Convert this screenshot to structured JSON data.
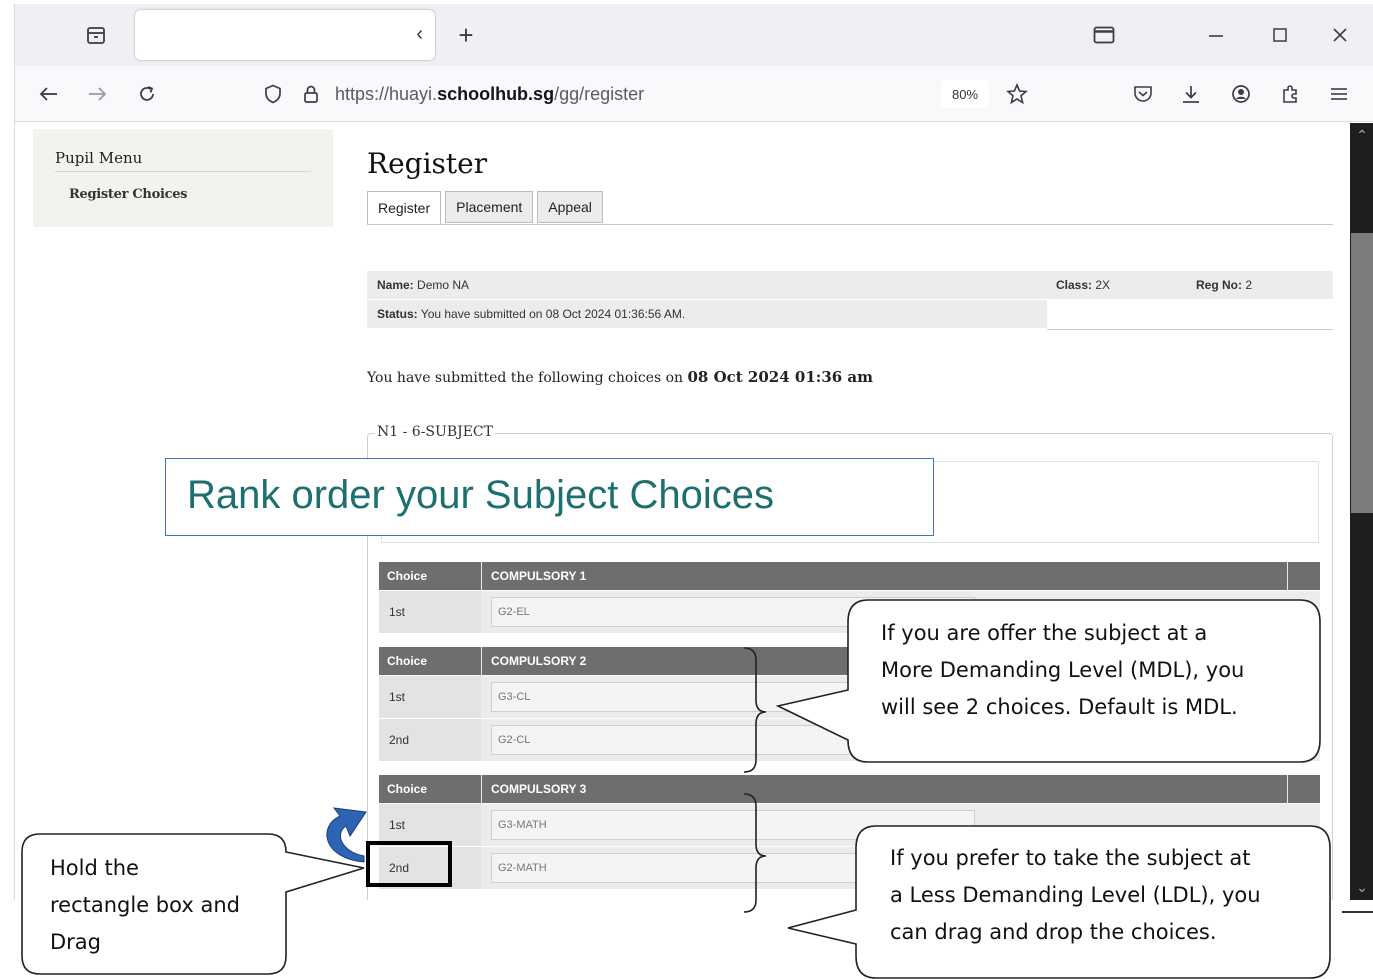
{
  "browser": {
    "url_prefix": "https://huayi.",
    "url_host": "schoolhub.sg",
    "url_path": "/gg/register",
    "zoom": "80%",
    "tab_close_glyph": "‹",
    "new_tab_glyph": "+",
    "icons": [
      "tab-overview-icon",
      "close-tab-icon",
      "new-tab-icon",
      "picture-in-picture-icon",
      "minimize-icon",
      "maximize-icon",
      "close-window-icon",
      "back-icon",
      "forward-icon",
      "reload-icon",
      "shield-icon",
      "lock-icon",
      "bookmark-star-icon",
      "pocket-icon",
      "download-icon",
      "account-icon",
      "extensions-icon",
      "menu-icon"
    ]
  },
  "sidebar": {
    "title": "Pupil Menu",
    "items": [
      {
        "label": "Register Choices"
      }
    ]
  },
  "page": {
    "title": "Register",
    "tabs": [
      {
        "label": "Register",
        "active": true
      },
      {
        "label": "Placement"
      },
      {
        "label": "Appeal"
      }
    ]
  },
  "student": {
    "name_label": "Name:",
    "name": "Demo NA",
    "class_label": "Class:",
    "class": "2X",
    "regno_label": "Reg No:",
    "regno": "2",
    "status_label": "Status:",
    "status": "You have submitted on 08 Oct 2024 01:36:56 AM."
  },
  "submitted": {
    "prefix": "You have submitted the following choices on",
    "datetime": "08 Oct 2024 01:36 am"
  },
  "choices": {
    "legend": "N1 - 6-SUBJECT",
    "choice_header": "Choice",
    "groups": [
      {
        "title": "COMPULSORY 1",
        "rows": [
          {
            "rank": "1st",
            "value": "G2-EL"
          }
        ]
      },
      {
        "title": "COMPULSORY 2",
        "rows": [
          {
            "rank": "1st",
            "value": "G3-CL"
          },
          {
            "rank": "2nd",
            "value": "G2-CL"
          }
        ]
      },
      {
        "title": "COMPULSORY 3",
        "rows": [
          {
            "rank": "1st",
            "value": "G3-MATH"
          },
          {
            "rank": "2nd",
            "value": "G2-MATH"
          }
        ]
      }
    ]
  },
  "annotations": {
    "banner": "Rank order your Subject Choices",
    "mdl_callout": [
      "If you are offer the subject at a",
      "More Demanding Level (MDL), you",
      "will see 2 choices. Default is MDL."
    ],
    "ldl_callout": [
      "If you prefer to take the subject at",
      "a Less Demanding Level (LDL), you",
      "can drag and drop the choices."
    ],
    "drag_callout": [
      "Hold the",
      "rectangle box and",
      "Drag"
    ]
  },
  "colors": {
    "banner_text": "#1e6f6f",
    "banner_border": "#4472c4",
    "curved_arrow": "#2e64b4",
    "table_header": "#6e6e6e"
  }
}
